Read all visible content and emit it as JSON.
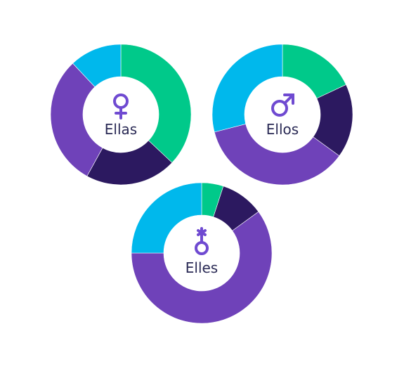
{
  "colors": {
    "green": "#00c98a",
    "navy": "#2c1960",
    "purple": "#6f42b9",
    "cyan": "#00b8ec",
    "symbol": "#6f4ad1",
    "label": "#2a2a55"
  },
  "chart_data": [
    {
      "type": "pie",
      "label": "Ellas",
      "symbol": "female-symbol-icon",
      "series": [
        {
          "color": "green",
          "value": 37
        },
        {
          "color": "navy",
          "value": 21
        },
        {
          "color": "purple",
          "value": 30
        },
        {
          "color": "cyan",
          "value": 12
        }
      ]
    },
    {
      "type": "pie",
      "label": "Ellos",
      "symbol": "male-symbol-icon",
      "series": [
        {
          "color": "green",
          "value": 18
        },
        {
          "color": "navy",
          "value": 17
        },
        {
          "color": "purple",
          "value": 36
        },
        {
          "color": "cyan",
          "value": 29
        }
      ]
    },
    {
      "type": "pie",
      "label": "Elles",
      "symbol": "nonbinary-symbol-icon",
      "series": [
        {
          "color": "green",
          "value": 5
        },
        {
          "color": "navy",
          "value": 10
        },
        {
          "color": "purple",
          "value": 60
        },
        {
          "color": "cyan",
          "value": 25
        }
      ]
    }
  ]
}
